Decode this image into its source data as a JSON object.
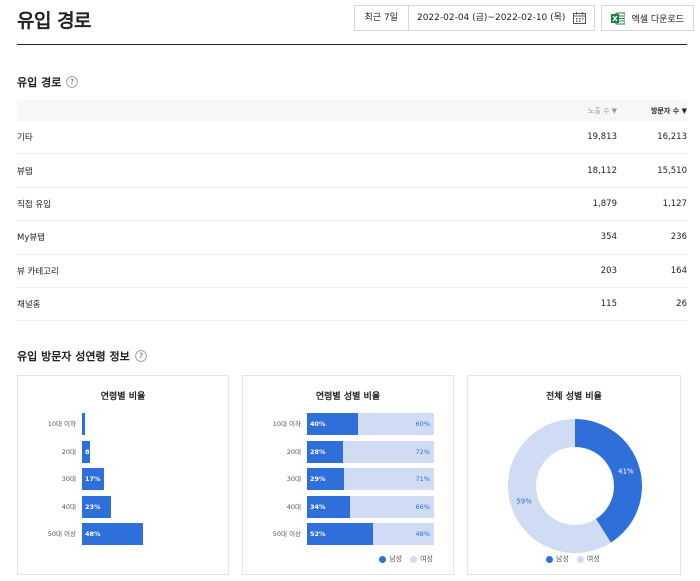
{
  "header": {
    "title": "유입 경로",
    "period_button": "최근 7일",
    "date_range": "2022-02-04 (금)~2022-02-10 (목)",
    "excel_button": "엑셀 다운로드"
  },
  "traffic_section": {
    "title": "유입 경로",
    "columns": {
      "impressions": "노출 수 ▼",
      "visitors": "방문자 수 ▼"
    },
    "rows": [
      {
        "name": "기타",
        "impressions": "19,813",
        "visitors": "16,213"
      },
      {
        "name": "뷰탭",
        "impressions": "18,112",
        "visitors": "15,510"
      },
      {
        "name": "직접 유입",
        "impressions": "1,879",
        "visitors": "1,127"
      },
      {
        "name": "My뷰탭",
        "impressions": "354",
        "visitors": "236"
      },
      {
        "name": "뷰 카테고리",
        "impressions": "203",
        "visitors": "164"
      },
      {
        "name": "채널홈",
        "impressions": "115",
        "visitors": "26"
      }
    ]
  },
  "demographics_section": {
    "title": "유입 방문자 성연령 정보"
  },
  "colors": {
    "male": "#2f6fd9",
    "female": "#cfdcf3"
  },
  "chart_data": [
    {
      "type": "bar",
      "title": "연령별 비율",
      "categories": [
        "10대 이하",
        "20대",
        "30대",
        "40대",
        "50대 이상"
      ],
      "values": [
        2,
        6,
        17,
        23,
        48
      ],
      "labels": [
        "",
        "8",
        "17%",
        "23%",
        "48%"
      ]
    },
    {
      "type": "bar",
      "title": "연령별 성별 비율",
      "categories": [
        "10대 이하",
        "20대",
        "30대",
        "40대",
        "50대 이상"
      ],
      "series": [
        {
          "name": "남성",
          "values": [
            40,
            28,
            29,
            34,
            52
          ]
        },
        {
          "name": "여성",
          "values": [
            60,
            72,
            71,
            66,
            48
          ]
        }
      ],
      "legend": [
        "남성",
        "여성"
      ]
    },
    {
      "type": "pie",
      "title": "전체 성별 비율",
      "categories": [
        "남성",
        "여성"
      ],
      "values": [
        41,
        59
      ],
      "legend": [
        "남성",
        "여성"
      ]
    }
  ]
}
